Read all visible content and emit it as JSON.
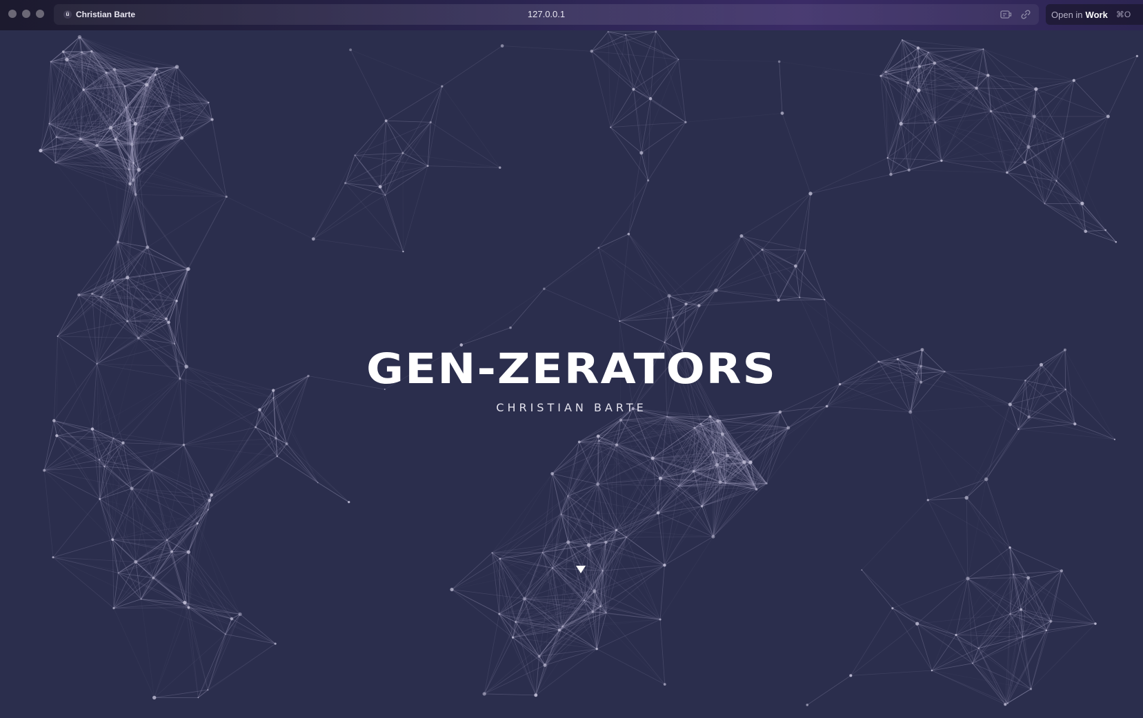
{
  "browser": {
    "tab_title": "Christian Barte",
    "url": "127.0.0.1",
    "open_in": {
      "prefix": "Open in",
      "workspace": "Work",
      "shortcut": "⌘O"
    }
  },
  "hero": {
    "title": "GEN-ZERATORS",
    "subtitle": "CHRISTIAN BARTE"
  },
  "colors": {
    "background": "#2b2e4d",
    "node": "#b9b7cf",
    "line": "#9a98b8",
    "text": "#ffffff"
  },
  "icons": {
    "favicon": "smiley-icon",
    "reader": "reader-mode-icon",
    "link": "link-icon",
    "scroll": "triangle-down-icon"
  }
}
